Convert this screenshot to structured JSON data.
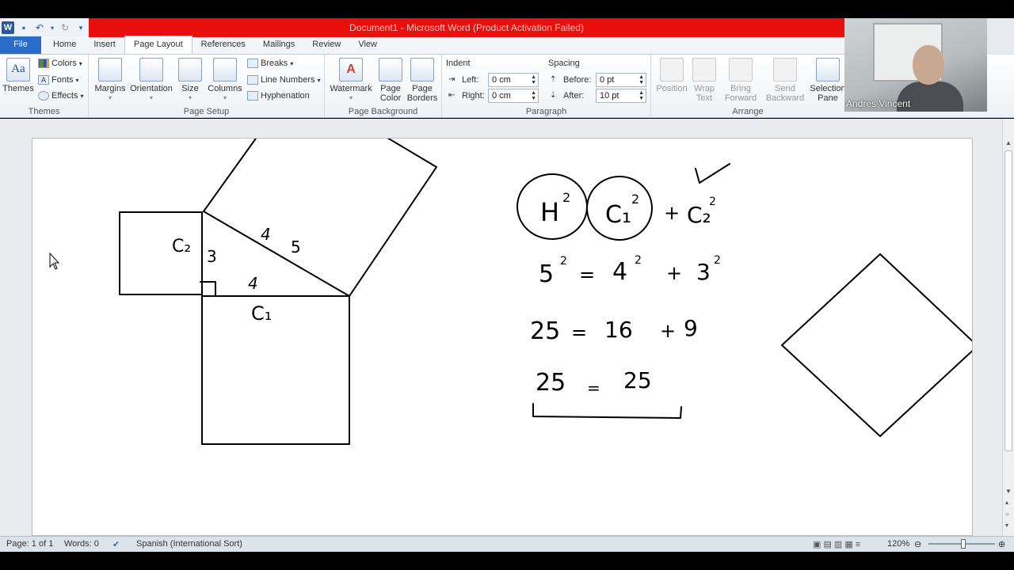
{
  "window": {
    "title": "Document1 - Microsoft Word (Product Activation Failed)"
  },
  "tabs": [
    "File",
    "Home",
    "Insert",
    "Page Layout",
    "References",
    "Mailings",
    "Review",
    "View"
  ],
  "ribbon": {
    "themes": {
      "themes_label": "Themes",
      "colors": "Colors",
      "fonts": "Fonts",
      "effects": "Effects",
      "group": "Themes"
    },
    "page_setup": {
      "margins": "Margins",
      "orientation": "Orientation",
      "size": "Size",
      "columns": "Columns",
      "breaks": "Breaks",
      "line_numbers": "Line Numbers",
      "hyphenation": "Hyphenation",
      "group": "Page Setup"
    },
    "page_background": {
      "watermark": "Watermark",
      "page_color": "Page\nColor",
      "page_borders": "Page\nBorders",
      "group": "Page Background"
    },
    "paragraph": {
      "indent": "Indent",
      "left_label": "Left:",
      "left_value": "0 cm",
      "right_label": "Right:",
      "right_value": "0 cm",
      "spacing": "Spacing",
      "before_label": "Before:",
      "before_value": "0 pt",
      "after_label": "After:",
      "after_value": "10 pt",
      "group": "Paragraph"
    },
    "arrange": {
      "position": "Position",
      "wrap_text": "Wrap\nText",
      "bring_forward": "Bring\nForward",
      "send_backward": "Send\nBackward",
      "selection_pane": "Selection\nPane",
      "group": "Arrange"
    }
  },
  "webcam": {
    "name": "Andres Vincent"
  },
  "document": {
    "handwriting": {
      "c2": "C₂",
      "three": "3",
      "four_hyp": "4",
      "five": "5",
      "four_base": "4",
      "c1": "C₁",
      "eq1_h": "H",
      "eq1_c1": "C₁",
      "eq1_plus": "+",
      "eq1_c2": "C₂",
      "eq1_sup": "2",
      "eq2": [
        "5",
        "=",
        "4",
        "+",
        "3"
      ],
      "eq3": [
        "25",
        "=",
        "16",
        "+",
        "9"
      ],
      "eq4": [
        "25",
        "=",
        "25"
      ]
    }
  },
  "status": {
    "page": "Page: 1 of 1",
    "words": "Words: 0",
    "language": "Spanish (International Sort)",
    "zoom": "120%"
  },
  "colors": {
    "title_bar": "#e8100e",
    "file_tab": "#2a6dc8",
    "ink": "#000000"
  }
}
